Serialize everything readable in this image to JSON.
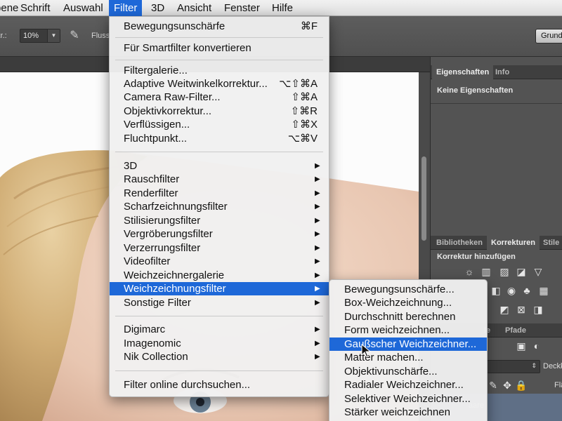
{
  "menubar": {
    "items": [
      {
        "label": "Ebene"
      },
      {
        "label": "Schrift"
      },
      {
        "label": "Auswahl"
      },
      {
        "label": "Filter"
      },
      {
        "label": "3D"
      },
      {
        "label": "Ansicht"
      },
      {
        "label": "Fenster"
      },
      {
        "label": "Hilfe"
      }
    ],
    "active": "Filter"
  },
  "options_bar": {
    "opacity_label": "Deckkr.:",
    "opacity_value": "10%",
    "flow_label": "Fluss",
    "workspace_button": "Grund"
  },
  "filter_menu": {
    "groups": [
      [
        {
          "label": "Bewegungsunschärfe",
          "shortcut": "⌘F"
        }
      ],
      [
        {
          "label": "Für Smartfilter konvertieren",
          "shortcut": ""
        }
      ],
      [
        {
          "label": "Filtergalerie...",
          "shortcut": ""
        },
        {
          "label": "Adaptive Weitwinkelkorrektur...",
          "shortcut": "⌥⇧⌘A"
        },
        {
          "label": "Camera Raw-Filter...",
          "shortcut": "⇧⌘A"
        },
        {
          "label": "Objektivkorrektur...",
          "shortcut": "⇧⌘R"
        },
        {
          "label": "Verflüssigen...",
          "shortcut": "⇧⌘X"
        },
        {
          "label": "Fluchtpunkt...",
          "shortcut": "⌥⌘V"
        }
      ],
      [
        {
          "label": "3D",
          "submenu": true
        },
        {
          "label": "Rauschfilter",
          "submenu": true
        },
        {
          "label": "Renderfilter",
          "submenu": true
        },
        {
          "label": "Scharfzeichnungsfilter",
          "submenu": true
        },
        {
          "label": "Stilisierungsfilter",
          "submenu": true
        },
        {
          "label": "Vergröberungsfilter",
          "submenu": true
        },
        {
          "label": "Verzerrungsfilter",
          "submenu": true
        },
        {
          "label": "Videofilter",
          "submenu": true
        },
        {
          "label": "Weichzeichnergalerie",
          "submenu": true
        },
        {
          "label": "Weichzeichnungsfilter",
          "submenu": true,
          "highlighted": true
        },
        {
          "label": "Sonstige Filter",
          "submenu": true
        }
      ],
      [
        {
          "label": "Digimarc",
          "submenu": true
        },
        {
          "label": "Imagenomic",
          "submenu": true
        },
        {
          "label": "Nik Collection",
          "submenu": true
        }
      ],
      [
        {
          "label": "Filter online durchsuchen...",
          "shortcut": ""
        }
      ]
    ]
  },
  "blur_submenu": {
    "items": [
      {
        "label": "Bewegungsunschärfe..."
      },
      {
        "label": "Box-Weichzeichnung..."
      },
      {
        "label": "Durchschnitt berechnen"
      },
      {
        "label": "Form weichzeichnen..."
      },
      {
        "label": "Gaußscher Weichzeichner...",
        "highlighted": true
      },
      {
        "label": "Matter machen..."
      },
      {
        "label": "Objektivunschärfe..."
      },
      {
        "label": "Radialer Weichzeichner..."
      },
      {
        "label": "Selektiver Weichzeichner..."
      },
      {
        "label": "Stärker weichzeichnen"
      }
    ]
  },
  "properties_panel": {
    "tabs": [
      "Eigenschaften",
      "Info"
    ],
    "active_tab": "Eigenschaften",
    "empty_text": "Keine Eigenschaften"
  },
  "adjustments_panel": {
    "tabs": [
      "Bibliotheken",
      "Korrekturen",
      "Stile"
    ],
    "active_tab": "Korrekturen",
    "heading": "Korrektur hinzufügen"
  },
  "layers_panel": {
    "tabs_visible": [
      "Kanäle",
      "Pfade"
    ],
    "visible_partial_labels": [
      "le",
      "Pfade",
      "Deckk",
      "Flä",
      "aare"
    ]
  },
  "colors": {
    "menu_highlight": "#1e68d8",
    "panel_bg": "#535353",
    "menu_bg": "#f0f0f0"
  }
}
